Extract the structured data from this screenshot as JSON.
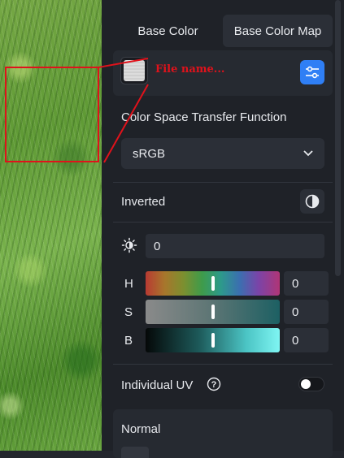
{
  "tabs": [
    {
      "label": "Base Color",
      "active": false
    },
    {
      "label": "Base Color Map",
      "active": true
    }
  ],
  "texture_map": {
    "file_name_placeholder": "File name...",
    "settings_icon": "sliders-icon"
  },
  "color_space": {
    "label": "Color Space Transfer Function",
    "selected": "sRGB",
    "chevron_icon": "chevron-down-icon"
  },
  "inverted": {
    "label": "Inverted",
    "icon": "half-circle-contrast-icon"
  },
  "brightness": {
    "icon": "brightness-sun-icon",
    "value": "0"
  },
  "hsb": [
    {
      "label": "H",
      "value": "0",
      "slider_level": 0.5
    },
    {
      "label": "S",
      "value": "0",
      "slider_level": 0.5
    },
    {
      "label": "B",
      "value": "0",
      "slider_level": 0.5
    }
  ],
  "individual_uv": {
    "label": "Individual UV",
    "help_icon": "question-circle-icon",
    "enabled": false
  },
  "normal": {
    "label": "Normal"
  },
  "colors": {
    "accent": "#2f7ff5",
    "annotation": "#e0121b",
    "panel_bg": "#1f2228"
  }
}
